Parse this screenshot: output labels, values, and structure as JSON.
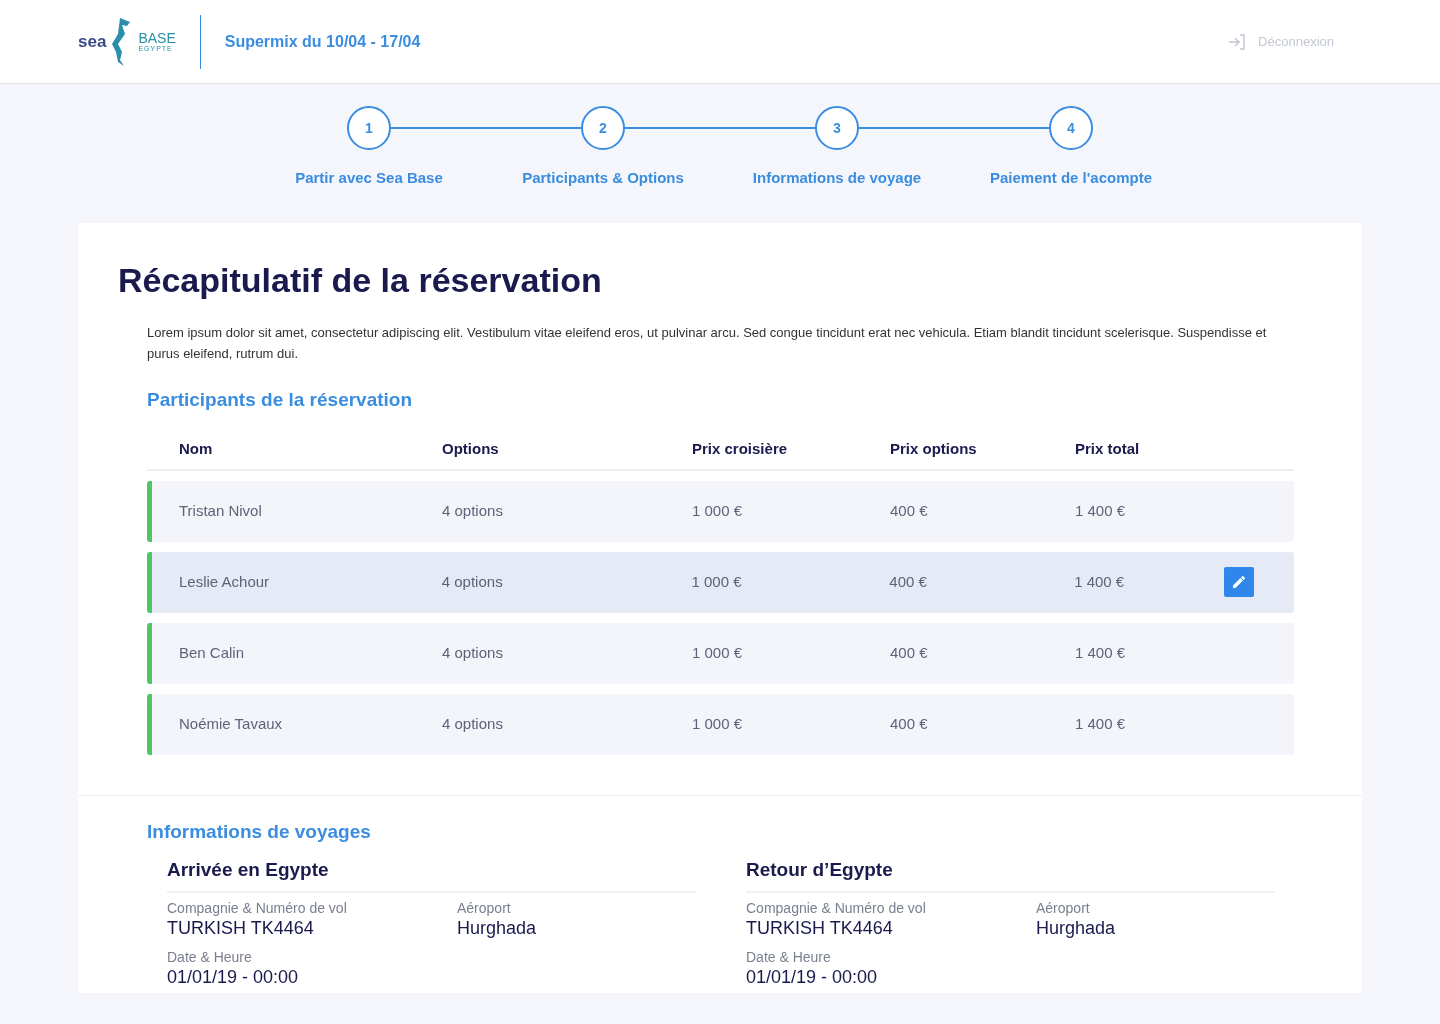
{
  "header": {
    "logo": {
      "word": "sea",
      "brand": "BASE",
      "tagline": "EGYPTE"
    },
    "trip_title": "Supermix du 10/04 - 17/04",
    "logout": "Déconnexion"
  },
  "steps": [
    {
      "number": "1",
      "label": "Partir avec Sea Base"
    },
    {
      "number": "2",
      "label": "Participants & Options"
    },
    {
      "number": "3",
      "label": "Informations de voyage"
    },
    {
      "number": "4",
      "label": "Paiement de l'acompte"
    }
  ],
  "summary": {
    "title": "Récapitulatif de la réservation",
    "intro": "Lorem ipsum dolor sit amet, consectetur adipiscing elit. Vestibulum vitae eleifend eros, ut pulvinar arcu. Sed congue tincidunt erat nec vehicula. Etiam blandit tincidunt scelerisque. Suspendisse et purus eleifend, rutrum dui.",
    "participants_title": "Participants de la réservation",
    "columns": [
      "Nom",
      "Options",
      "Prix croisière",
      "Prix options",
      "Prix total"
    ],
    "rows": [
      {
        "cells": [
          "Tristan Nivol",
          "4 options",
          "1 000 €",
          "400 €",
          "1 400 €"
        ],
        "selected": false
      },
      {
        "cells": [
          "Leslie Achour",
          "4 options",
          "1 000 €",
          "400 €",
          "1 400 €"
        ],
        "selected": true
      },
      {
        "cells": [
          "Ben Calin",
          "4 options",
          "1 000 €",
          "400 €",
          "1 400 €"
        ],
        "selected": false
      },
      {
        "cells": [
          "Noémie Tavaux",
          "4 options",
          "1 000 €",
          "400 €",
          "1 400 €"
        ],
        "selected": false
      }
    ]
  },
  "travel": {
    "title": "Informations de voyages",
    "legs": [
      {
        "title": "Arrivée en Egypte",
        "fields": [
          {
            "label": "Compagnie & Numéro de vol",
            "value": "TURKISH TK4464"
          },
          {
            "label": "Aéroport",
            "value": "Hurghada"
          },
          {
            "label": "Date & Heure",
            "value": "01/01/19 - 00:00"
          }
        ]
      },
      {
        "title": "Retour d’Egypte",
        "fields": [
          {
            "label": "Compagnie & Numéro de vol",
            "value": "TURKISH TK4464"
          },
          {
            "label": "Aéroport",
            "value": "Hurghada"
          },
          {
            "label": "Date & Heure",
            "value": "01/01/19 - 00:00"
          }
        ]
      }
    ]
  }
}
